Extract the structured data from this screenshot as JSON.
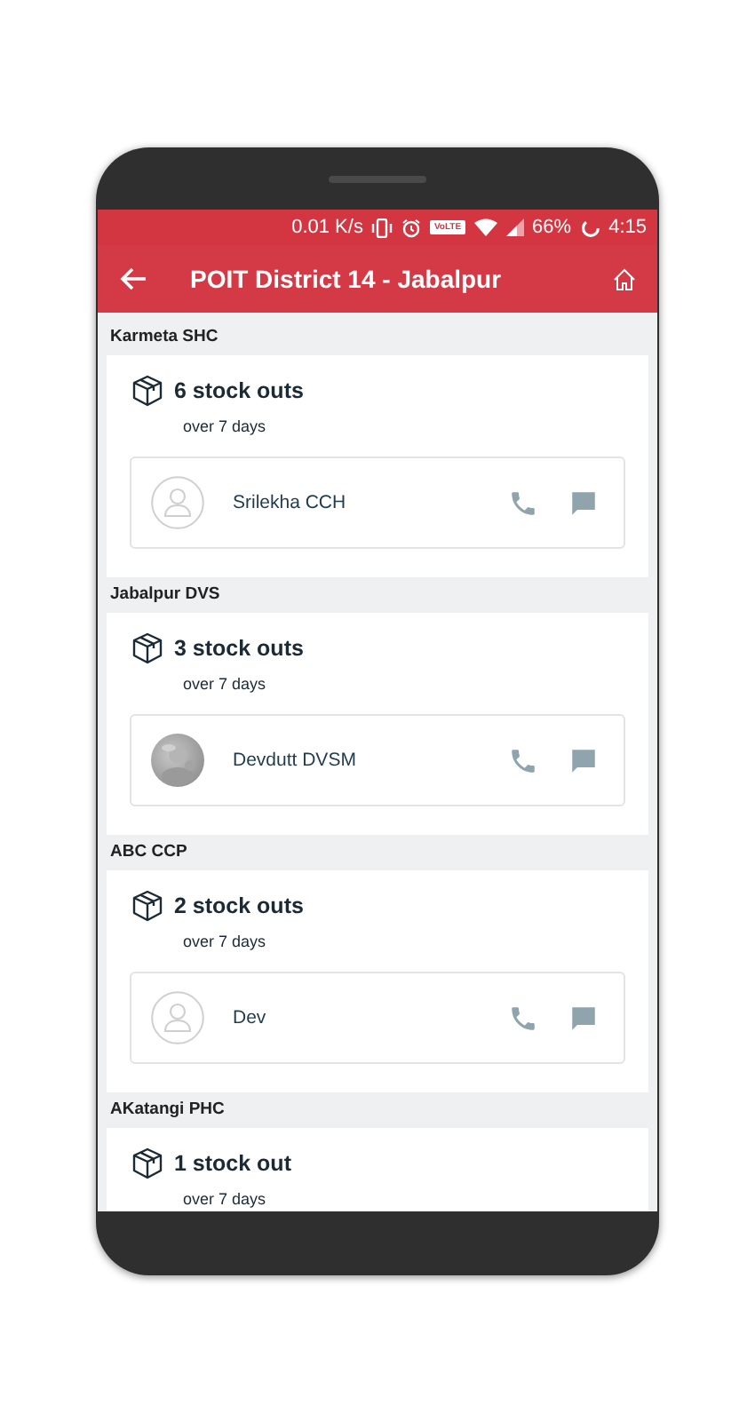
{
  "status_bar": {
    "speed": "0.01 K/s",
    "network": "VoLTE",
    "battery": "66%",
    "time": "4:15"
  },
  "app_bar": {
    "title": "POIT District 14 - Jabalpur"
  },
  "facilities": [
    {
      "name": "Karmeta SHC",
      "stock_outs": "6 stock outs",
      "period": "over 7 days",
      "contact": {
        "kind": "placeholder",
        "name": "Srilekha CCH"
      }
    },
    {
      "name": "Jabalpur DVS",
      "stock_outs": "3 stock outs",
      "period": "over 7 days",
      "contact": {
        "name": "Devdutt DVSM"
      }
    },
    {
      "name": "ABC CCP",
      "stock_outs": "2 stock outs",
      "period": "over 7 days",
      "contact": {
        "kind": "placeholder",
        "name": "Dev"
      }
    },
    {
      "name": "AKatangi PHC",
      "stock_outs": "1 stock out",
      "period": "over 7 days"
    }
  ]
}
